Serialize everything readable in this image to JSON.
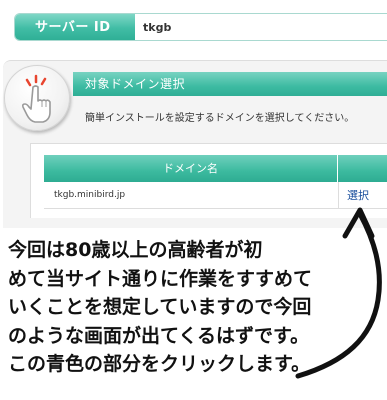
{
  "server_bar": {
    "label": "サーバー ID",
    "value": "tkgb"
  },
  "panel": {
    "title": "対象ドメイン選択",
    "description": "簡単インストールを設定するドメインを選択してください。",
    "icon": "hand-pointer-icon"
  },
  "table": {
    "header_domain": "ドメイン名",
    "rows": [
      {
        "domain": "tkgb.minibird.jp",
        "action": "選択"
      }
    ]
  },
  "annotation": {
    "lines": [
      "今回は80歳以上の高齢者が初",
      "めて当サイト通りに作業をすすめて",
      "いくことを想定していますので今回",
      "のような画面が出てくるはずです。",
      "この青色の部分をクリックします。"
    ]
  },
  "colors": {
    "accent_teal": "#3dbba2",
    "link_blue": "#1a4f9c",
    "annotation_text": "#111111"
  }
}
